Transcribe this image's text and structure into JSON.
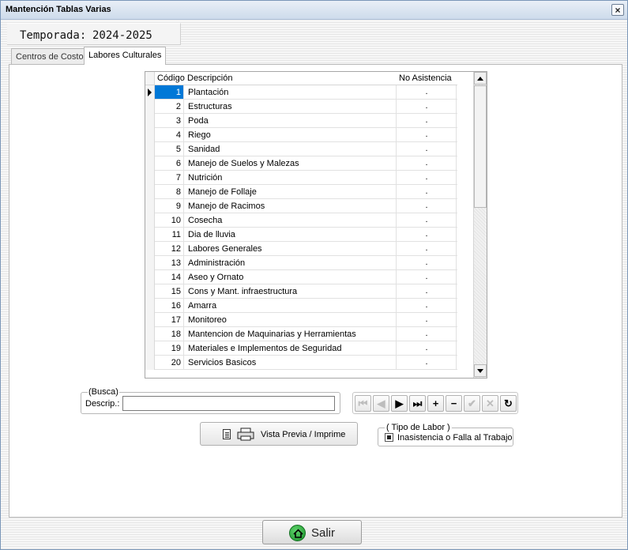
{
  "window": {
    "title": "Mantención Tablas Varias"
  },
  "season": {
    "label": "Temporada:",
    "value": "2024-2025"
  },
  "tabs": [
    {
      "label": "Centros de Costo",
      "active": false
    },
    {
      "label": "Labores Culturales",
      "active": true
    }
  ],
  "grid": {
    "headers": {
      "code": "Código",
      "desc": "Descripción",
      "na": "No Asistencia"
    },
    "rows": [
      {
        "code": "1",
        "desc": "Plantación",
        "na": "."
      },
      {
        "code": "2",
        "desc": "Estructuras",
        "na": "."
      },
      {
        "code": "3",
        "desc": "Poda",
        "na": "."
      },
      {
        "code": "4",
        "desc": "Riego",
        "na": "."
      },
      {
        "code": "5",
        "desc": "Sanidad",
        "na": "."
      },
      {
        "code": "6",
        "desc": "Manejo de Suelos y Malezas",
        "na": "."
      },
      {
        "code": "7",
        "desc": "Nutrición",
        "na": "."
      },
      {
        "code": "8",
        "desc": "Manejo de Follaje",
        "na": "."
      },
      {
        "code": "9",
        "desc": "Manejo de Racimos",
        "na": "."
      },
      {
        "code": "10",
        "desc": "Cosecha",
        "na": "."
      },
      {
        "code": "11",
        "desc": "Dia de lluvia",
        "na": "."
      },
      {
        "code": "12",
        "desc": "Labores Generales",
        "na": "."
      },
      {
        "code": "13",
        "desc": "Administración",
        "na": "."
      },
      {
        "code": "14",
        "desc": "Aseo y Ornato",
        "na": "."
      },
      {
        "code": "15",
        "desc": "Cons y Mant. infraestructura",
        "na": "."
      },
      {
        "code": "16",
        "desc": "Amarra",
        "na": "."
      },
      {
        "code": "17",
        "desc": "Monitoreo",
        "na": "."
      },
      {
        "code": "18",
        "desc": "Mantencion de Maquinarias y Herramientas",
        "na": "."
      },
      {
        "code": "19",
        "desc": "Materiales e Implementos de Seguridad",
        "na": "."
      },
      {
        "code": "20",
        "desc": "Servicios Basicos",
        "na": "."
      }
    ],
    "selected_index": 0,
    "selection_color": "#0078d7"
  },
  "search": {
    "legend": "(Busca)",
    "label": "Descrip.:",
    "value": "",
    "placeholder": ""
  },
  "navigator": {
    "buttons": [
      {
        "icon": "first-record-icon",
        "glyph": "⏮",
        "enabled": false
      },
      {
        "icon": "prior-record-icon",
        "glyph": "◀",
        "enabled": false
      },
      {
        "icon": "next-record-icon",
        "glyph": "▶",
        "enabled": true
      },
      {
        "icon": "last-record-icon",
        "glyph": "⏭",
        "enabled": true
      },
      {
        "icon": "insert-record-icon",
        "glyph": "+",
        "enabled": true
      },
      {
        "icon": "delete-record-icon",
        "glyph": "−",
        "enabled": true
      },
      {
        "icon": "post-record-icon",
        "glyph": "✔",
        "enabled": false
      },
      {
        "icon": "cancel-record-icon",
        "glyph": "✕",
        "enabled": false
      },
      {
        "icon": "refresh-icon",
        "glyph": "↻",
        "enabled": true
      }
    ]
  },
  "print": {
    "label": "Vista Previa / Imprime"
  },
  "labor_type": {
    "legend": "( Tipo de Labor )",
    "checkbox_label": "Inasistencia o Falla al Trabajo",
    "checked": true
  },
  "exit": {
    "label": "Salir",
    "icon_color": "#19912a"
  }
}
